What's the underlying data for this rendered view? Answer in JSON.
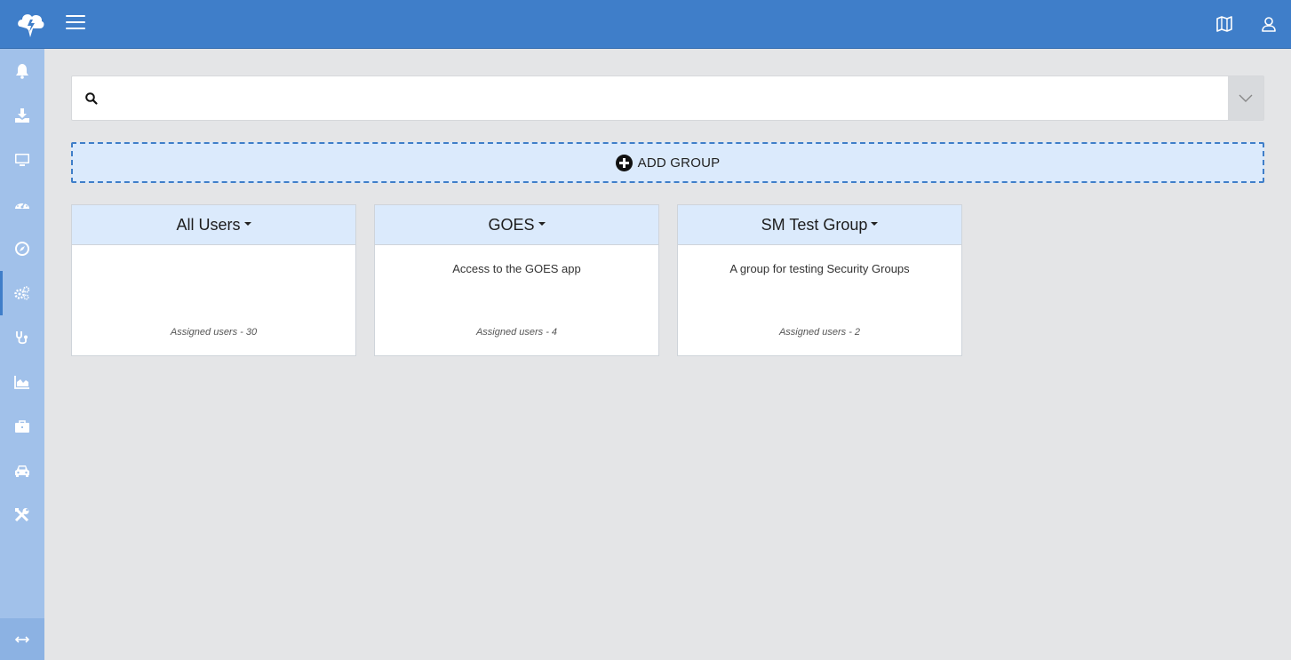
{
  "search": {
    "value": "",
    "placeholder": ""
  },
  "actions": {
    "add_group_label": "ADD GROUP"
  },
  "groups": [
    {
      "name": "All Users",
      "description": "",
      "count_label": "Assigned users - 30"
    },
    {
      "name": "GOES",
      "description": "Access to the GOES app",
      "count_label": "Assigned users - 4"
    },
    {
      "name": "SM Test Group",
      "description": "A group for testing Security Groups",
      "count_label": "Assigned users - 2"
    }
  ],
  "sidebar": {
    "items": [
      {
        "icon": "bell-icon"
      },
      {
        "icon": "download-icon"
      },
      {
        "icon": "monitor-icon"
      },
      {
        "icon": "dashboard-gauge-icon"
      },
      {
        "icon": "compass-icon"
      },
      {
        "icon": "gears-icon",
        "active": true
      },
      {
        "icon": "stethoscope-icon"
      },
      {
        "icon": "area-chart-icon"
      },
      {
        "icon": "briefcase-icon"
      },
      {
        "icon": "car-icon"
      },
      {
        "icon": "tools-icon"
      }
    ],
    "footer_icon": "expand-horizontal-icon"
  },
  "header": {
    "icons": [
      "logo-icon",
      "menu-icon",
      "map-icon",
      "user-icon"
    ]
  },
  "colors": {
    "topbar": "#3f7ec9",
    "sidebar": "#a1c1ea",
    "card_header": "#dbeafc",
    "background": "#e4e5e7"
  }
}
